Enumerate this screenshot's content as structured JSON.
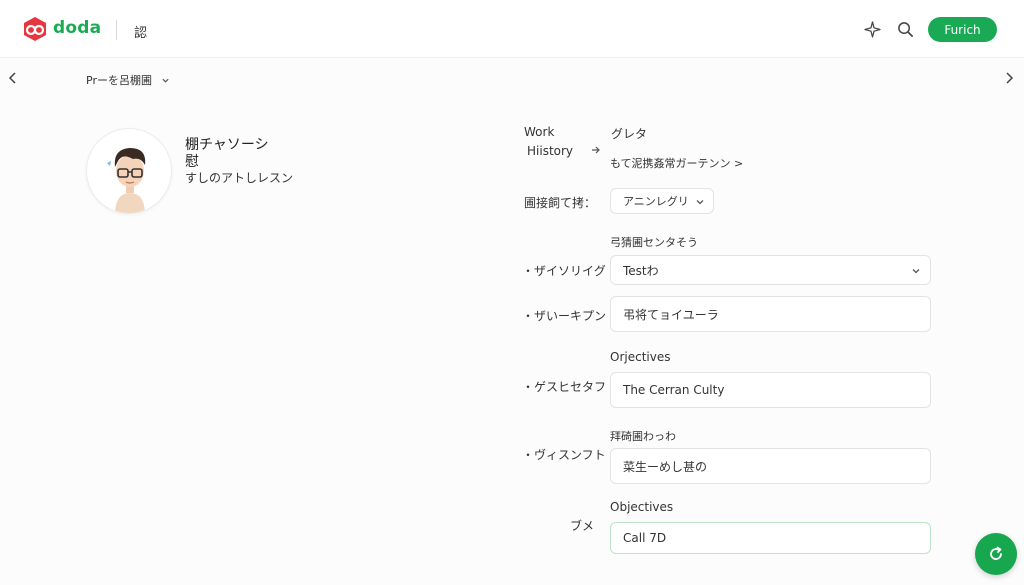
{
  "header": {
    "brand": "doda",
    "nav_label": "認",
    "primary_button": "Furich",
    "icons": [
      "doda-logo-icon",
      "sparkle-icon",
      "search-icon"
    ]
  },
  "subbar": {
    "breadcrumb": "Prーを呂棚圃"
  },
  "profile": {
    "name": "棚チャソーシ\n慰",
    "subtitle": "すしのアトしレスン"
  },
  "form": {
    "work_history_label_1": "Work",
    "work_history_label_2": "Hiistory",
    "work_history_value": "グレタ",
    "work_history_detail": "もて泥携姦常ガーテンン >",
    "select1_label": "圃接飼て拷：",
    "select1_value": "アニンレグリ",
    "section1_heading": "弓猜圃センタそう",
    "field1_label": "・ザイソリイグ",
    "field1_value": "Testわ",
    "field2_label": "・ザいーキプン",
    "field2_value": "弔将てョイユーラ",
    "section2_heading": "Orjectives",
    "field3_label": "・ゲスヒセタフト",
    "field3_value": "The Cerran Culty",
    "section3_heading": "拜碕圃わっわ",
    "field4_label": "・ヴィスンフト",
    "field4_value": "菜生ーめし甚の",
    "section4_heading": "Objectives",
    "field5_label": "ブメ",
    "field5_value": "Call 7D"
  },
  "colors": {
    "brand_green": "#19ac52",
    "logo_red": "#e6373f",
    "background": "#fbfcfb"
  }
}
